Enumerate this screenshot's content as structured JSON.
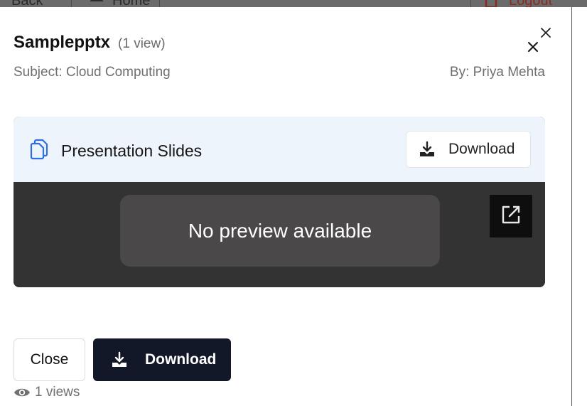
{
  "background": {
    "back_label": "Back",
    "home_label": "Home",
    "logout_label": "Logout"
  },
  "modal": {
    "title": "Samplepptx",
    "views_inline": "(1 view)",
    "subject": "Subject: Cloud Computing",
    "author": "By: Priya Mehta",
    "file_card": {
      "title": "Presentation Slides",
      "download_label": "Download",
      "no_preview_text": "No preview available"
    },
    "actions": {
      "close_label": "Close",
      "download_label": "Download"
    },
    "footer_views": "1 views"
  },
  "icons": {
    "file": "copy-files-icon",
    "download": "download-tray-icon",
    "open_external": "external-link-icon",
    "close": "close-icon",
    "eye": "eye-icon"
  },
  "colors": {
    "accent_blue": "#2f6fe0",
    "primary_button": "#121827",
    "card_header": "#eef4fc",
    "preview_bg": "#333333",
    "logout_red": "#c0392b"
  }
}
